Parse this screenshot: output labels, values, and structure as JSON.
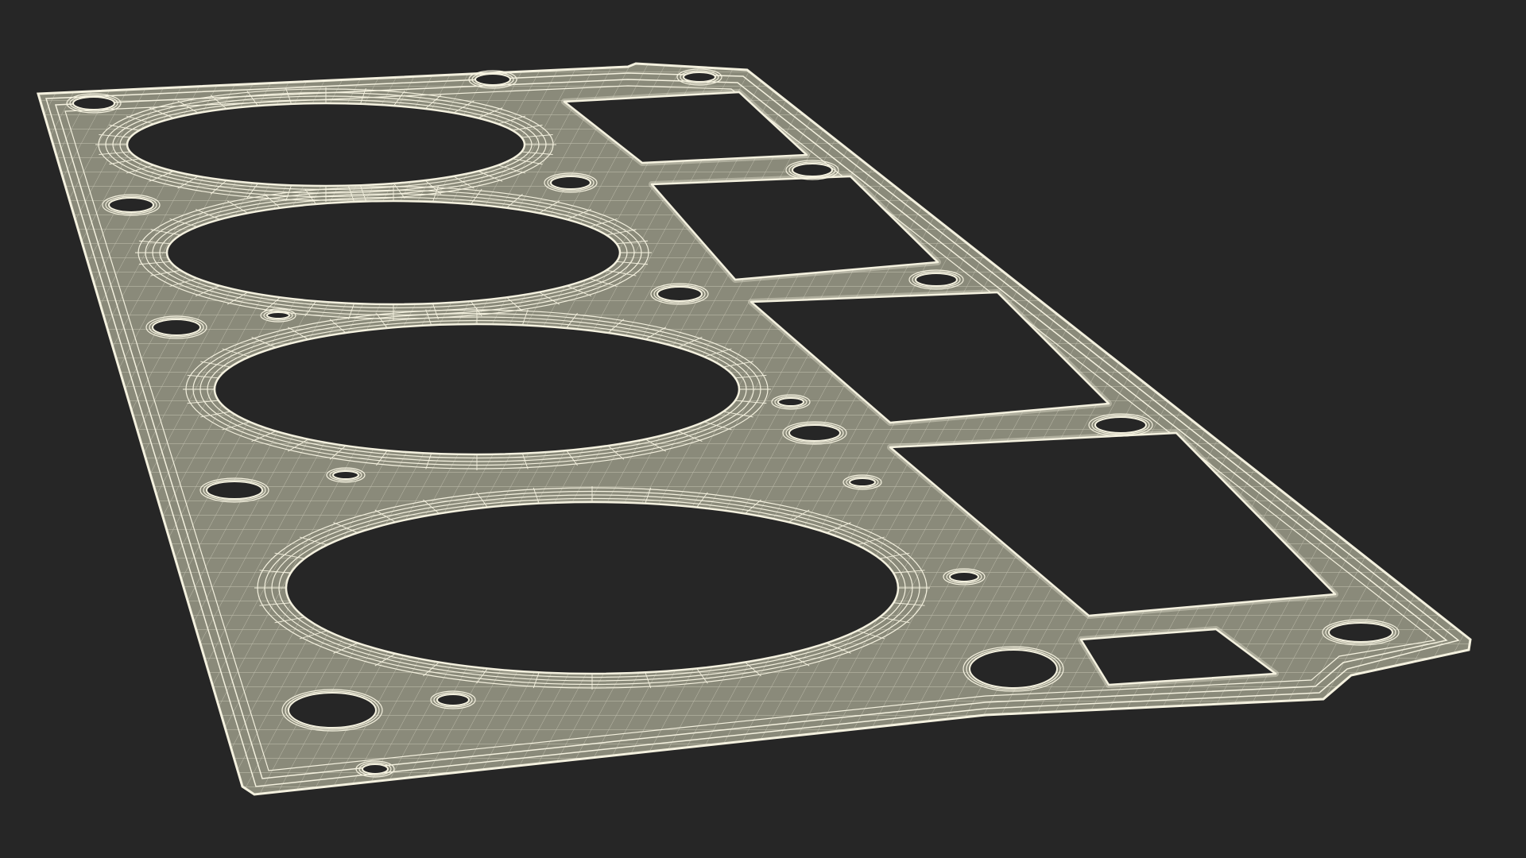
{
  "scene": {
    "subject": "gasket-wireframe-render",
    "colors": {
      "background": "#262626",
      "surface": "#8a8a7a",
      "wire": "#f4f1df",
      "hole": "#262626"
    },
    "cylinder_bores": 4,
    "coolant_ports": 4
  }
}
